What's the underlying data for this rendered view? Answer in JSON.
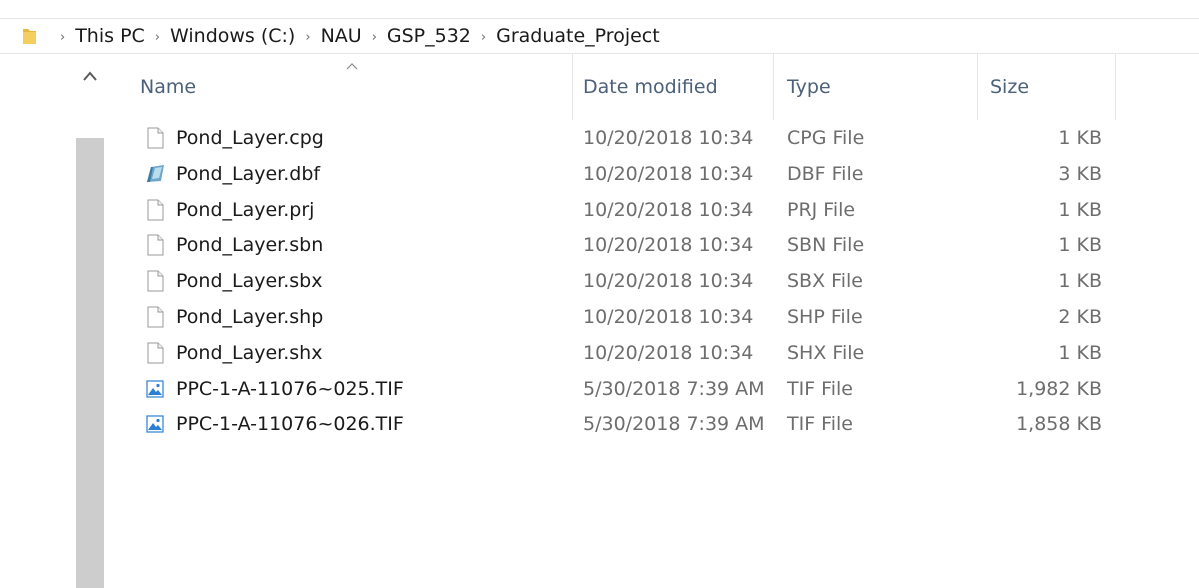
{
  "breadcrumb": {
    "items": [
      "This PC",
      "Windows (C:)",
      "NAU",
      "GSP_532",
      "Graduate_Project"
    ]
  },
  "columns": {
    "name": "Name",
    "date": "Date modified",
    "type": "Type",
    "size": "Size"
  },
  "files": [
    {
      "name": "Pond_Layer.cpg",
      "date": "10/20/2018 10:34",
      "type": "CPG File",
      "size": "1 KB",
      "icon": "blank-file-icon"
    },
    {
      "name": "Pond_Layer.dbf",
      "date": "10/20/2018 10:34",
      "type": "DBF File",
      "size": "3 KB",
      "icon": "database-file-icon"
    },
    {
      "name": "Pond_Layer.prj",
      "date": "10/20/2018 10:34",
      "type": "PRJ File",
      "size": "1 KB",
      "icon": "blank-file-icon"
    },
    {
      "name": "Pond_Layer.sbn",
      "date": "10/20/2018 10:34",
      "type": "SBN File",
      "size": "1 KB",
      "icon": "blank-file-icon"
    },
    {
      "name": "Pond_Layer.sbx",
      "date": "10/20/2018 10:34",
      "type": "SBX File",
      "size": "1 KB",
      "icon": "blank-file-icon"
    },
    {
      "name": "Pond_Layer.shp",
      "date": "10/20/2018 10:34",
      "type": "SHP File",
      "size": "2 KB",
      "icon": "blank-file-icon"
    },
    {
      "name": "Pond_Layer.shx",
      "date": "10/20/2018 10:34",
      "type": "SHX File",
      "size": "1 KB",
      "icon": "blank-file-icon"
    },
    {
      "name": "PPC-1-A-11076~025.TIF",
      "date": "5/30/2018 7:39 AM",
      "type": "TIF File",
      "size": "1,982 KB",
      "icon": "image-file-icon"
    },
    {
      "name": "PPC-1-A-11076~026.TIF",
      "date": "5/30/2018 7:39 AM",
      "type": "TIF File",
      "size": "1,858 KB",
      "icon": "image-file-icon"
    }
  ],
  "colors": {
    "header_text": "#4c607a",
    "scrollbar_thumb": "#cdcdcd",
    "folder": "#e8b73b",
    "image_icon": "#2a7fd4"
  }
}
